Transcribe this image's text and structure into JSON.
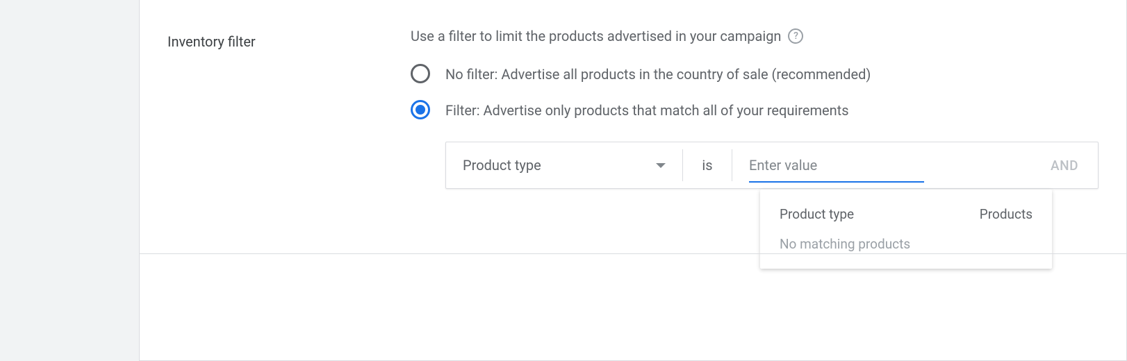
{
  "section": {
    "title": "Inventory filter",
    "description": "Use a filter to limit the products advertised in your campaign"
  },
  "radio": {
    "no_filter": "No filter: Advertise all products in the country of sale (recommended)",
    "filter": "Filter: Advertise only products that match all of your requirements"
  },
  "filter_row": {
    "field": "Product type",
    "operator": "is",
    "value_placeholder": "Enter value",
    "and_label": "AND"
  },
  "dropdown": {
    "col1": "Product type",
    "col2": "Products",
    "empty": "No matching products"
  }
}
